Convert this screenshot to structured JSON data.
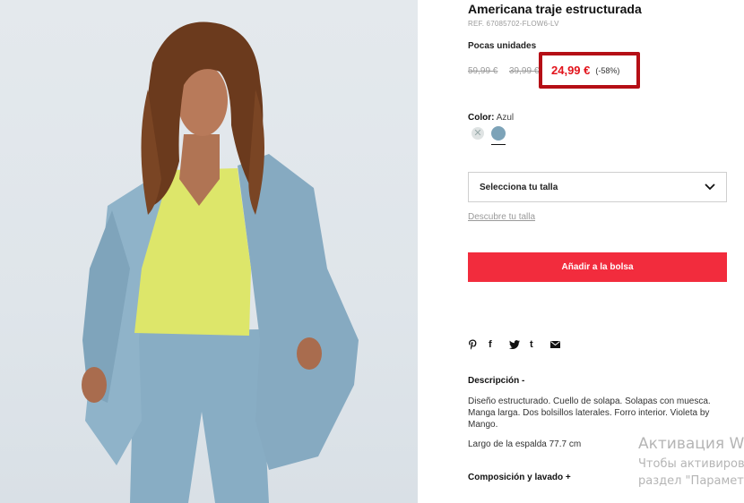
{
  "product": {
    "title": "Americana traje estructurada",
    "ref": "REF. 67085702-FLOW6-LV",
    "stock_label": "Pocas unidades",
    "original_price": "59,99 €",
    "intermediate_price": "39,99 €",
    "price": "24,99 €",
    "discount": "(-58%)",
    "accent_color": "#e2131b",
    "highlight_box_color": "#b50f16"
  },
  "color": {
    "label": "Color:",
    "value": "Azul",
    "swatches": [
      {
        "name": "unavailable",
        "icon": "close-icon"
      },
      {
        "name": "Azul",
        "hex": "#7da3b8",
        "selected": true
      }
    ]
  },
  "size": {
    "select_label": "Selecciona tu talla",
    "guide_link": "Descubre tu talla"
  },
  "actions": {
    "add_to_bag": "Añadir a la bolsa",
    "add_button_color": "#f22c3d"
  },
  "share": {
    "icons": [
      "pinterest-icon",
      "facebook-icon",
      "twitter-icon",
      "tumblr-icon",
      "mail-icon"
    ],
    "facebook_glyph": "f",
    "tumblr_glyph": "t"
  },
  "description": {
    "title": "Descripción -",
    "text": "Diseño estructurado. Cuello de solapa. Solapas con muesca. Manga larga. Dos bolsillos laterales. Forro interior. Violeta by Mango.",
    "length": "Largo de la espalda 77.7 cm"
  },
  "composition": {
    "title": "Composición y lavado +"
  },
  "watermark": {
    "line1": "Активация W",
    "line2": "Чтобы активиров",
    "line3": "раздел \"Парамет"
  }
}
